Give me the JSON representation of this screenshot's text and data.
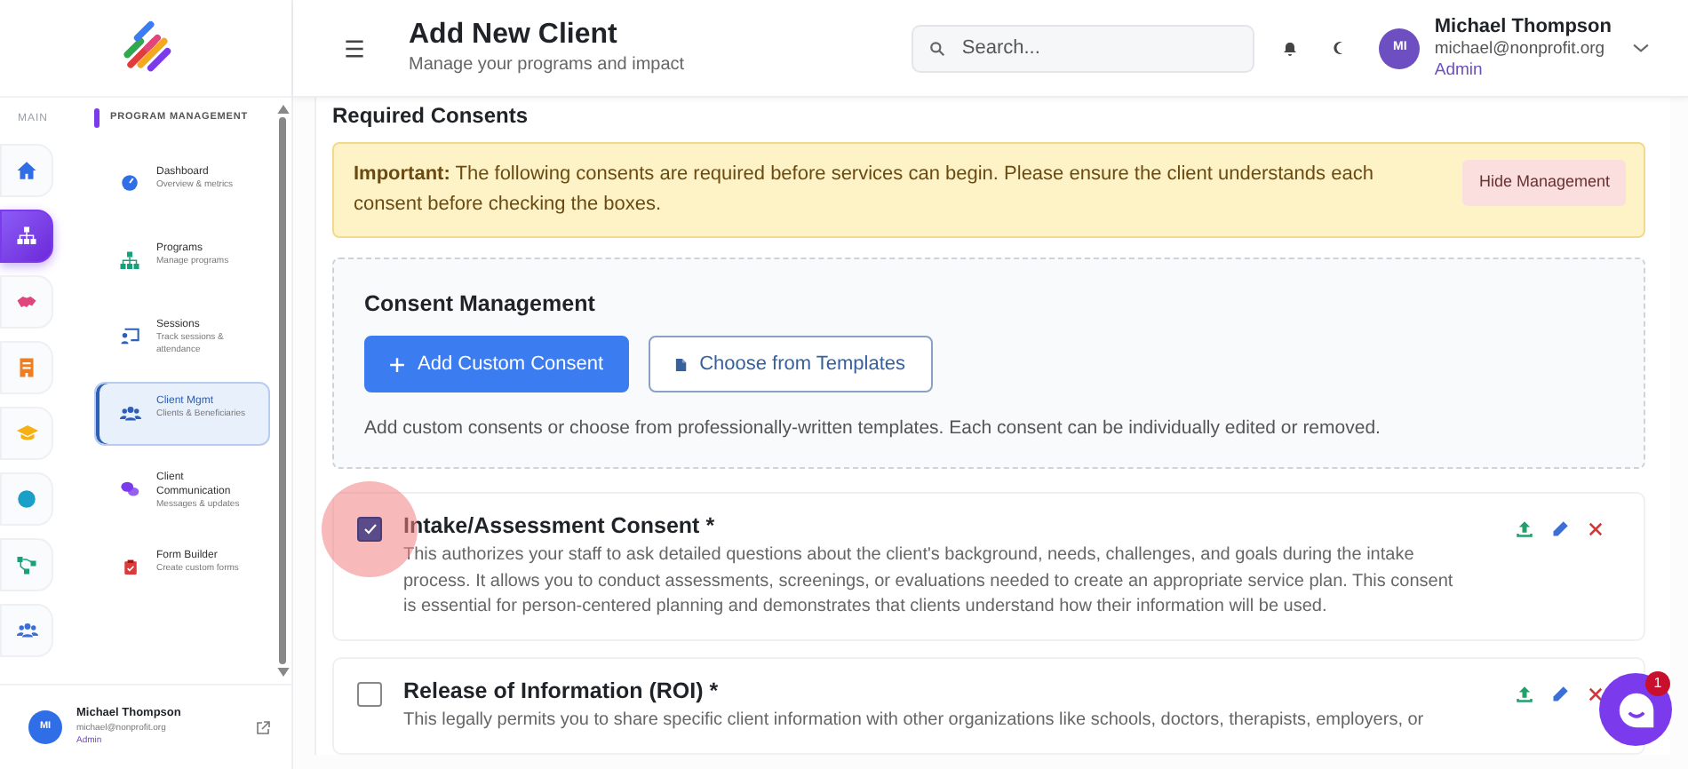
{
  "sidebar": {
    "rail_label": "MAIN",
    "rail_items": [
      {
        "selected": false
      },
      {
        "selected": true
      },
      {
        "selected": false
      },
      {
        "selected": false
      },
      {
        "selected": false
      },
      {
        "selected": false
      },
      {
        "selected": false
      },
      {
        "selected": false
      }
    ],
    "section_title": "PROGRAM MANAGEMENT",
    "menu_items": [
      {
        "title": "Dashboard",
        "subtitle": "Overview & metrics",
        "selected": false
      },
      {
        "title": "Programs",
        "subtitle": "Manage programs",
        "selected": false
      },
      {
        "title": "Sessions",
        "subtitle": "Track sessions & attendance",
        "selected": false
      },
      {
        "title": "Client Mgmt",
        "subtitle": "Clients & Beneficiaries",
        "selected": true
      },
      {
        "title": "Client Communication",
        "subtitle": "Messages & updates",
        "selected": false
      },
      {
        "title": "Form Builder",
        "subtitle": "Create custom forms",
        "selected": false
      }
    ],
    "user": {
      "initials": "MI",
      "name": "Michael Thompson",
      "email": "michael@nonprofit.org",
      "role": "Admin"
    }
  },
  "header": {
    "title": "Add New Client",
    "subtitle": "Manage your programs and impact",
    "search_placeholder": "Search...",
    "user": {
      "initials": "MI",
      "name": "Michael Thompson",
      "email": "michael@nonprofit.org",
      "role": "Admin"
    }
  },
  "main": {
    "section_heading": "Required Consents",
    "alert": {
      "text": "**Important:** The following consents are required before services can begin. Please ensure the client understands each consent before checking the boxes.",
      "button": "Hide Management"
    },
    "consent_management": {
      "title": "Consent Management",
      "buttons": [
        {
          "kind": "primary",
          "label": "Add Custom Consent"
        },
        {
          "kind": "outline",
          "label": "Choose from Templates"
        }
      ],
      "help": "Add custom consents or choose from professionally-written templates. Each consent can be individually edited or removed."
    },
    "consents": [
      {
        "title": "Intake/Assessment Consent *",
        "checked": true,
        "description": "This authorizes your staff to ask detailed questions about the client's background, needs, challenges, and goals during the intake process. It allows you to conduct assessments, screenings, or evaluations needed to create an appropriate service plan. This consent is essential for person-centered planning and demonstrates that clients understand how their information will be used."
      },
      {
        "title": "Release of Information (ROI) *",
        "checked": false,
        "description": "This legally permits you to share specific client information with other organizations like schools, doctors, therapists, employers, or"
      }
    ]
  },
  "chat": {
    "badge": "1"
  }
}
